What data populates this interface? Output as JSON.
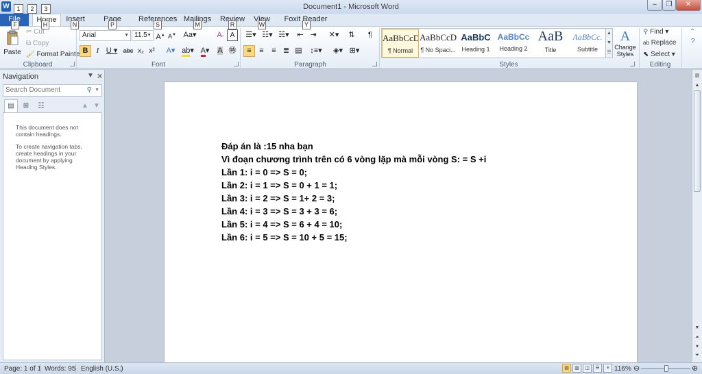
{
  "app": {
    "title": "Document1 - Microsoft Word",
    "icon_letter": "W",
    "qat_keytips": [
      "1",
      "2",
      "3"
    ]
  },
  "tabs": [
    {
      "label": "File",
      "key": "F"
    },
    {
      "label": "Home",
      "key": "H"
    },
    {
      "label": "Insert",
      "key": "N"
    },
    {
      "label": "Page Layout",
      "key": "P"
    },
    {
      "label": "References",
      "key": "S"
    },
    {
      "label": "Mailings",
      "key": "M"
    },
    {
      "label": "Review",
      "key": "R"
    },
    {
      "label": "View",
      "key": "W"
    },
    {
      "label": "Foxit Reader PDF",
      "key": "Y"
    }
  ],
  "ribbon": {
    "clipboard": {
      "label": "Clipboard",
      "paste": "Paste",
      "cut": "Cut",
      "copy": "Copy",
      "format_painter": "Format Painter"
    },
    "font": {
      "label": "Font",
      "font_name": "Arial",
      "font_size": "11.5"
    },
    "paragraph": {
      "label": "Paragraph"
    },
    "styles": {
      "label": "Styles",
      "items": [
        {
          "preview": "AaBbCcD",
          "name": "¶ Normal"
        },
        {
          "preview": "AaBbCcD",
          "name": "¶ No Spaci..."
        },
        {
          "preview": "AaBbC",
          "name": "Heading 1"
        },
        {
          "preview": "AaBbCc",
          "name": "Heading 2"
        },
        {
          "preview": "AaB",
          "name": "Title"
        },
        {
          "preview": "AaBbCc.",
          "name": "Subtitle"
        }
      ],
      "change_styles": "Change Styles"
    },
    "editing": {
      "label": "Editing",
      "find": "Find",
      "replace": "Replace",
      "select": "Select"
    }
  },
  "navigation": {
    "title": "Navigation",
    "search_placeholder": "Search Document",
    "message_1": "This document does not contain headings.",
    "message_2": "To create navigation tabs, create headings in your document by applying Heading Styles."
  },
  "document": {
    "lines": [
      "Đáp án là :15 nha bạn",
      "Vì đoạn chương trình trên có 6 vòng lặp mà mỗi vòng S: = S +i",
      "Lần 1: i = 0 => S = 0;",
      "Lần 2: i = 1 => S = 0 + 1 = 1;",
      "Lần 3: i = 2 => S = 1+ 2 = 3;",
      "Lần 4: i = 3 => S = 3 + 3 = 6;",
      "Lần 5: i = 4 => S = 6 + 4 = 10;",
      "Lần 6: i = 5 => S = 10 + 5 = 15;"
    ]
  },
  "status": {
    "page": "Page: 1 of 1",
    "words": "Words: 95",
    "language": "English (U.S.)",
    "zoom": "116%"
  }
}
